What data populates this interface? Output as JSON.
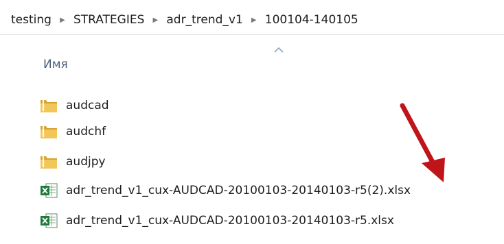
{
  "breadcrumb": {
    "items": [
      {
        "label": "testing"
      },
      {
        "label": "STRATEGIES"
      },
      {
        "label": "adr_trend_v1"
      },
      {
        "label": "100104-140105"
      }
    ]
  },
  "columns": {
    "name_header": "Имя",
    "sort_direction": "ascending"
  },
  "files": [
    {
      "name": "audcad",
      "type": "folder"
    },
    {
      "name": "audchf",
      "type": "folder"
    },
    {
      "name": "audjpy",
      "type": "folder"
    },
    {
      "name": "adr_trend_v1_cux-AUDCAD-20100103-20140103-r5(2).xlsx",
      "type": "excel"
    },
    {
      "name": "adr_trend_v1_cux-AUDCAD-20100103-20140103-r5.xlsx",
      "type": "excel"
    }
  ],
  "annotation": {
    "color": "#c0141b",
    "points_to": "adr_trend_v1_cux-AUDCAD-20100103-20140103-r5(2).xlsx"
  },
  "colors": {
    "folder": "#e8b84a",
    "excel": "#1e7a3a",
    "header_text": "#4c607a"
  }
}
